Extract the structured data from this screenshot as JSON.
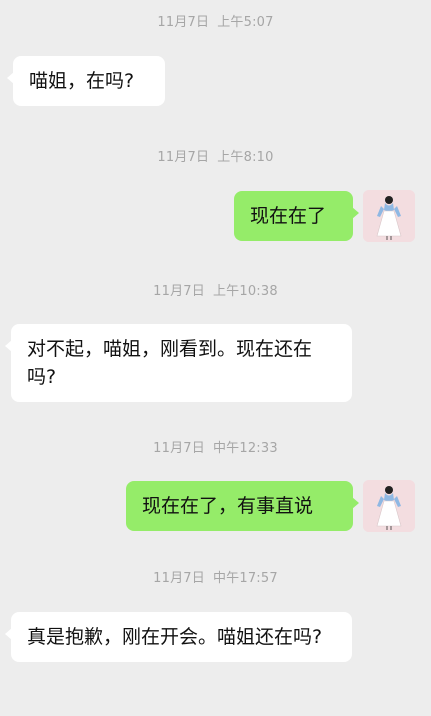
{
  "messages": [
    {
      "time_date": "11月7日",
      "time_clock": "上午5:07",
      "text": "喵姐，在吗?",
      "direction": "incoming"
    },
    {
      "time_date": "11月7日",
      "time_clock": "上午8:10",
      "text": "现在在了",
      "direction": "outgoing"
    },
    {
      "time_date": "11月7日",
      "time_clock": "上午10:38",
      "text": "对不起，喵姐，刚看到。现在还在吗?",
      "direction": "incoming"
    },
    {
      "time_date": "11月7日",
      "time_clock": "中午12:33",
      "text": "现在在了，有事直说",
      "direction": "outgoing"
    },
    {
      "time_date": "11月7日",
      "time_clock": "中午17:57",
      "text": "真是抱歉，刚在开会。喵姐还在吗?",
      "direction": "incoming"
    }
  ],
  "avatar_icon": "girl-in-white-dress-avatar",
  "colors": {
    "background": "#ededed",
    "incoming_bubble": "#ffffff",
    "outgoing_bubble": "#95ec69",
    "timestamp": "#a6a6a6"
  }
}
